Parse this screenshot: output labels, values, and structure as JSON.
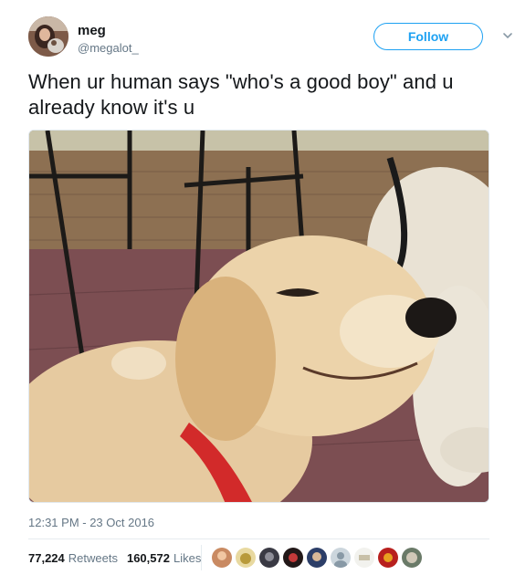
{
  "tweet": {
    "author": {
      "display_name": "meg",
      "handle": "@megalot_"
    },
    "follow_label": "Follow",
    "text": "When ur human says \"who's a good boy\" and u already know it's u",
    "timestamp": "12:31 PM - 23 Oct 2016",
    "retweets": {
      "count": "77,224",
      "label": "Retweets"
    },
    "likes": {
      "count": "160,572",
      "label": "Likes"
    }
  },
  "colors": {
    "accent": "#1da1f2",
    "secondary_text": "#657786"
  },
  "icons": [
    "chevron-down-icon"
  ]
}
